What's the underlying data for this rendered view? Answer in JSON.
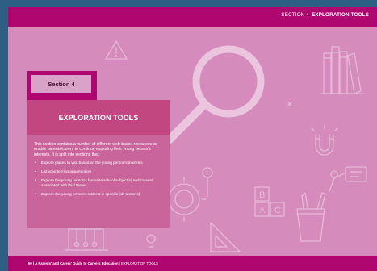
{
  "header": {
    "section_label": "SECTION 4",
    "section_title": "EXPLORATION TOOLS"
  },
  "section_tab": {
    "label": "Section 4"
  },
  "title_box": {
    "title": "EXPLORATION TOOLS"
  },
  "body": {
    "intro": "This section contains a number of different web-based resources to enable parents/carers to continue exploring their young person's interests. It is split into sections that:",
    "bullets": [
      "Explore places to visit based on the young person's interests",
      "List volunteering opportunities",
      "Explore the young person's favourite school subject(s) and careers associated with this/ these",
      "Explore the young person's interest in specific job sector(s)"
    ]
  },
  "footer": {
    "page_number": "50",
    "guide_title": "A Parents' and Carers' Guide to Careers Education",
    "section_title": "EXPLORATION TOOLS"
  },
  "colors": {
    "outer_background": "#2d5f84",
    "page_background": "#d58cbc",
    "brand_magenta": "#b0066f",
    "title_box": "#c2467f",
    "body_box": "#c9659b",
    "section_tab_fill": "#d9a3c8"
  },
  "icons": [
    "warning-icon",
    "magnifying-glass-icon",
    "books-icon",
    "magnet-icon",
    "pulley-icon",
    "target-icon",
    "abc-blocks-icon",
    "pencil-cup-icon",
    "ruler-triangle-icon",
    "newtons-cradle-icon",
    "lightbulb-icon",
    "person-with-board-icon",
    "rocket-icon",
    "cross-icon"
  ]
}
